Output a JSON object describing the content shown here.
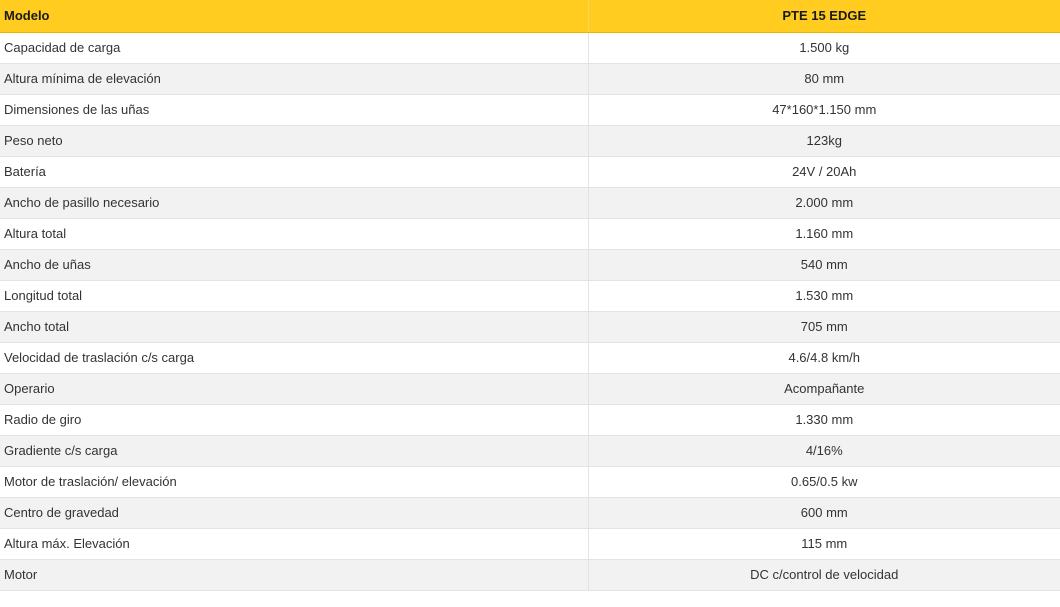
{
  "table": {
    "header": {
      "label": "Modelo",
      "value": "PTE 15 EDGE"
    },
    "rows": [
      {
        "label": "Capacidad de carga",
        "value": "1.500 kg"
      },
      {
        "label": "Altura mínima de elevación",
        "value": "80 mm"
      },
      {
        "label": "Dimensiones de las uñas",
        "value": "47*160*1.150 mm"
      },
      {
        "label": "Peso neto",
        "value": "123kg"
      },
      {
        "label": "Batería",
        "value": "24V / 20Ah"
      },
      {
        "label": "Ancho de pasillo necesario",
        "value": "2.000 mm"
      },
      {
        "label": "Altura total",
        "value": "1.160 mm"
      },
      {
        "label": "Ancho de uñas",
        "value": "540 mm"
      },
      {
        "label": "Longitud total",
        "value": "1.530 mm"
      },
      {
        "label": "Ancho total",
        "value": "705 mm"
      },
      {
        "label": "Velocidad de traslación c/s carga",
        "value": "4.6/4.8 km/h"
      },
      {
        "label": "Operario",
        "value": "Acompañante"
      },
      {
        "label": "Radio de giro",
        "value": "1.330 mm"
      },
      {
        "label": "Gradiente c/s carga",
        "value": "4/16%"
      },
      {
        "label": "Motor de traslación/ elevación",
        "value": "0.65/0.5 kw"
      },
      {
        "label": "Centro de gravedad",
        "value": "600 mm"
      },
      {
        "label": "Altura máx. Elevación",
        "value": "115 mm"
      },
      {
        "label": "Motor",
        "value": "DC c/control de velocidad"
      }
    ]
  },
  "colors": {
    "header_background": "#ffcc1f",
    "row_alt_background": "#f2f2f2",
    "text": "#333333"
  }
}
